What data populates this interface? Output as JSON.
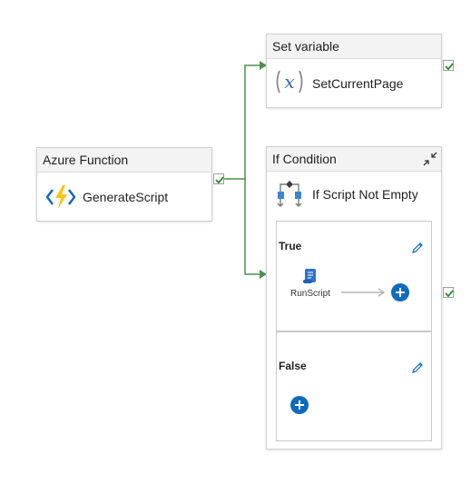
{
  "activities": {
    "azure_function": {
      "header": "Azure Function",
      "name": "GenerateScript",
      "icon": "azure-function-icon"
    },
    "set_variable": {
      "header": "Set variable",
      "name": "SetCurrentPage",
      "icon": "variable-icon"
    },
    "if_condition": {
      "header": "If Condition",
      "name": "If Script Not Empty",
      "icon": "if-condition-icon",
      "true_branch": {
        "title": "True",
        "activity_name": "RunScript",
        "activity_icon": "script-icon"
      },
      "false_branch": {
        "title": "False"
      }
    }
  },
  "colors": {
    "connector": "#4f8f4f",
    "accent": "#0f6cbd",
    "check": "#2e8b2e"
  }
}
